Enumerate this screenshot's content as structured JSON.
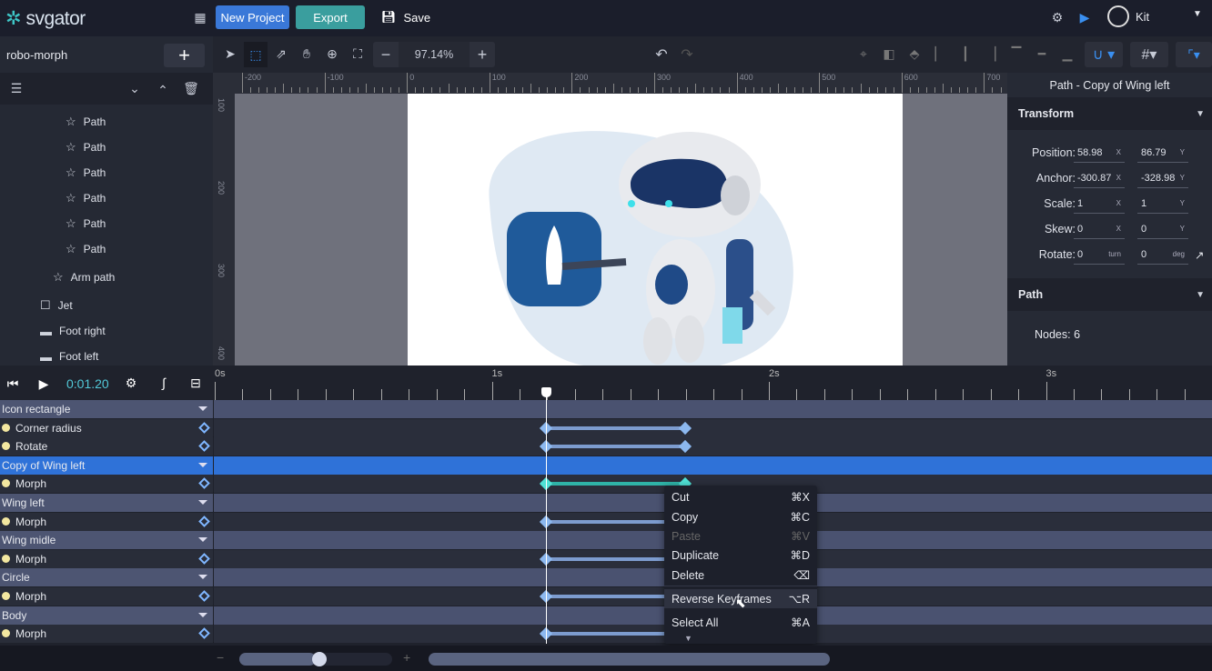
{
  "app": {
    "logo": "svgator",
    "new_project": "New Project",
    "export": "Export",
    "save": "Save",
    "user": "Kit"
  },
  "colors": {
    "accent": "#3ec7c7",
    "primary": "#3a78d8",
    "selected": "#2f72d8"
  },
  "project": {
    "name": "robo-morph"
  },
  "toolbar": {
    "zoom": "97.14%"
  },
  "ruler": {
    "h": [
      "-200",
      "-100",
      "0",
      "100",
      "200",
      "300",
      "400",
      "500",
      "600",
      "700"
    ],
    "v": [
      "100",
      "200",
      "300",
      "400"
    ]
  },
  "tree": [
    {
      "label": "Path",
      "icon": "star-path-icon"
    },
    {
      "label": "Path",
      "icon": "star-path-icon"
    },
    {
      "label": "Path",
      "icon": "star-path-icon"
    },
    {
      "label": "Path",
      "icon": "star-path-icon"
    },
    {
      "label": "Path",
      "icon": "star-path-icon"
    },
    {
      "label": "Path",
      "icon": "star-path-icon"
    },
    {
      "label": "Arm path",
      "icon": "star-path-icon"
    },
    {
      "label": "Jet",
      "icon": "square-icon"
    },
    {
      "label": "Foot right",
      "icon": "folder-icon"
    },
    {
      "label": "Foot left",
      "icon": "folder-icon"
    }
  ],
  "inspector": {
    "title": "Path - Copy of Wing left",
    "transform": "Transform",
    "rows": [
      {
        "label": "Position:",
        "x": "58.98",
        "xu": "X",
        "y": "86.79",
        "yu": "Y"
      },
      {
        "label": "Anchor:",
        "x": "-300.87",
        "xu": "X",
        "y": "-328.98",
        "yu": "Y"
      },
      {
        "label": "Scale:",
        "x": "1",
        "xu": "X",
        "y": "1",
        "yu": "Y"
      },
      {
        "label": "Skew:",
        "x": "0",
        "xu": "X",
        "y": "0",
        "yu": "Y"
      },
      {
        "label": "Rotate:",
        "x": "0",
        "xu": "turn",
        "y": "0",
        "yu": "deg"
      }
    ],
    "path": "Path",
    "nodes": "Nodes: 6"
  },
  "timeline": {
    "time": "0:01.20",
    "playhead_s": 1.2,
    "ticks": [
      "0s",
      "1s",
      "2s",
      "3s"
    ],
    "rows": [
      {
        "type": "g",
        "label": "Icon rectangle"
      },
      {
        "type": "p",
        "label": "Corner radius",
        "kf": [
          1.2,
          1.7
        ]
      },
      {
        "type": "p",
        "label": "Rotate",
        "kf": [
          1.2,
          1.7
        ]
      },
      {
        "type": "g",
        "label": "Copy of Wing left",
        "selected": true
      },
      {
        "type": "p",
        "label": "Morph",
        "kf": [
          1.2,
          1.7
        ],
        "active": true
      },
      {
        "type": "g",
        "label": "Wing left"
      },
      {
        "type": "p",
        "label": "Morph",
        "kf": [
          1.2,
          1.7
        ]
      },
      {
        "type": "g",
        "label": "Wing midle"
      },
      {
        "type": "p",
        "label": "Morph",
        "kf": [
          1.2,
          1.7
        ]
      },
      {
        "type": "g",
        "label": "Circle"
      },
      {
        "type": "p",
        "label": "Morph",
        "kf": [
          1.2,
          1.7
        ]
      },
      {
        "type": "g",
        "label": "Body"
      },
      {
        "type": "p",
        "label": "Morph",
        "kf": [
          1.2,
          1.7
        ]
      }
    ],
    "zoom_slider": 0.45
  },
  "context_menu": [
    {
      "label": "Cut",
      "shortcut": "⌘X"
    },
    {
      "label": "Copy",
      "shortcut": "⌘C"
    },
    {
      "label": "Paste",
      "shortcut": "⌘V",
      "disabled": true
    },
    {
      "label": "Duplicate",
      "shortcut": "⌘D"
    },
    {
      "label": "Delete",
      "shortcut": "⌫"
    },
    {
      "label": "Reverse Keyframes",
      "shortcut": "⌥R",
      "hover": true
    },
    {
      "label": "Select All",
      "shortcut": "⌘A"
    }
  ]
}
